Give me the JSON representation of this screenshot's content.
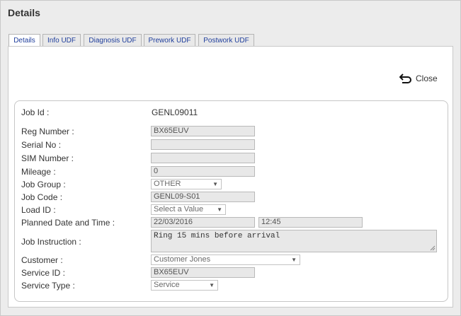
{
  "dialog": {
    "title": "Details"
  },
  "tabs": [
    {
      "label": "Details",
      "active": true
    },
    {
      "label": "Info UDF",
      "active": false
    },
    {
      "label": "Diagnosis UDF",
      "active": false
    },
    {
      "label": "Prework UDF",
      "active": false
    },
    {
      "label": "Postwork UDF",
      "active": false
    }
  ],
  "close": {
    "label": "Close",
    "icon": "undo-arrow-icon"
  },
  "form": {
    "job_id": {
      "label": "Job Id :",
      "value": "GENL09011"
    },
    "reg_number": {
      "label": "Reg Number :",
      "value": "BX65EUV"
    },
    "serial_no": {
      "label": "Serial No :",
      "value": ""
    },
    "sim_number": {
      "label": "SIM Number :",
      "value": ""
    },
    "mileage": {
      "label": "Mileage :",
      "value": "0"
    },
    "job_group": {
      "label": "Job Group :",
      "value": "OTHER"
    },
    "job_code": {
      "label": "Job Code :",
      "value": "GENL09-S01"
    },
    "load_id": {
      "label": "Load ID :",
      "value": "Select a Value"
    },
    "planned": {
      "label": "Planned Date and Time :",
      "date": "22/03/2016",
      "time": "12:45"
    },
    "job_instruction": {
      "label": "Job Instruction :",
      "value": "Ring 15 mins before arrival"
    },
    "customer": {
      "label": "Customer :",
      "value": "Customer Jones"
    },
    "service_id": {
      "label": "Service ID :",
      "value": "BX65EUV"
    },
    "service_type": {
      "label": "Service Type :",
      "value": "Service"
    }
  },
  "colors": {
    "tab_text": "#1f3e9c",
    "panel_bg": "#ffffff",
    "dialog_bg": "#ececec"
  }
}
